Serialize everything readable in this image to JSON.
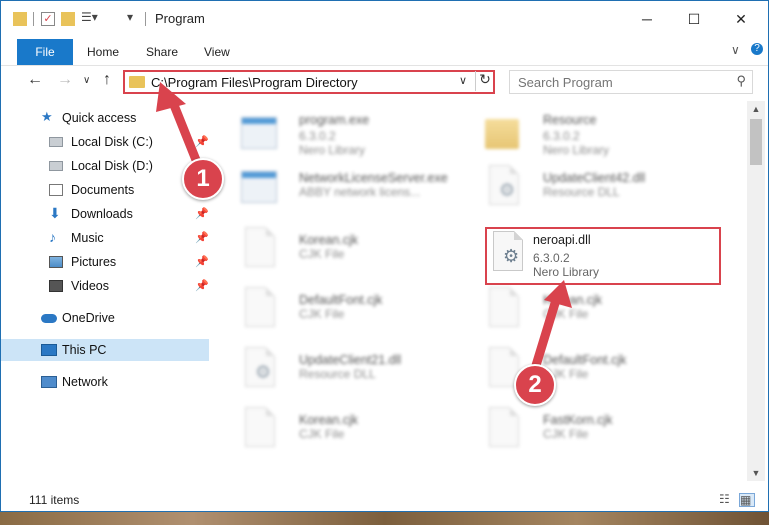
{
  "window": {
    "title": "Program",
    "controls": {
      "minimize": "─",
      "maximize": "☐",
      "close": "✕"
    }
  },
  "ribbon": {
    "tabs": [
      "File",
      "Home",
      "Share",
      "View"
    ],
    "collapse_glyph": "∨",
    "help_glyph": "?"
  },
  "address": {
    "path": "C:\\Program Files\\Program Directory",
    "dropdown_glyph": "∨",
    "refresh_glyph": "↻"
  },
  "search": {
    "placeholder": "Search Program",
    "icon": "search-icon"
  },
  "nav_pane": {
    "items": [
      {
        "label": "Quick access",
        "icon": "star-icon",
        "pinned": false
      },
      {
        "label": "Local Disk (C:)",
        "icon": "drive-icon",
        "pinned": true
      },
      {
        "label": "Local Disk (D:)",
        "icon": "drive-icon",
        "pinned": false
      },
      {
        "label": "Documents",
        "icon": "documents-icon",
        "pinned": false
      },
      {
        "label": "Downloads",
        "icon": "download-icon",
        "pinned": true
      },
      {
        "label": "Music",
        "icon": "music-icon",
        "pinned": true
      },
      {
        "label": "Pictures",
        "icon": "pictures-icon",
        "pinned": true
      },
      {
        "label": "Videos",
        "icon": "videos-icon",
        "pinned": true
      },
      {
        "label": "OneDrive",
        "icon": "cloud-icon",
        "pinned": false
      },
      {
        "label": "This PC",
        "icon": "pc-icon",
        "pinned": false,
        "selected": true
      },
      {
        "label": "Network",
        "icon": "network-icon",
        "pinned": false
      }
    ],
    "pin_glyph": "📌"
  },
  "files": [
    {
      "name": "program.exe",
      "version": "6.3.0.2",
      "type": "Nero Library",
      "icon": "exe-icon"
    },
    {
      "name": "Resource",
      "version": "6.3.0.2",
      "type": "Nero Library",
      "icon": "folder-icon"
    },
    {
      "name": "NetworkLicenseServer.exe",
      "version": "",
      "type": "ABBY network licens...",
      "icon": "exe-icon"
    },
    {
      "name": "UpdateClient42.dll",
      "version": "",
      "type": "Resource DLL",
      "icon": "dll-icon"
    },
    {
      "name": "Korean.cjk",
      "version": "",
      "type": "CJK File",
      "icon": "file-icon"
    },
    {
      "name": "neroapi.dll",
      "version": "6.3.0.2",
      "type": "Nero Library",
      "icon": "dll-icon",
      "highlighted": true
    },
    {
      "name": "DefaultFont.cjk",
      "version": "",
      "type": "CJK File",
      "icon": "file-icon"
    },
    {
      "name": "Korean.cjk",
      "version": "",
      "type": "CJK File",
      "icon": "file-icon"
    },
    {
      "name": "UpdateClient21.dll",
      "version": "",
      "type": "Resource DLL",
      "icon": "dll-icon"
    },
    {
      "name": "DefaultFont.cjk",
      "version": "",
      "type": "CJK File",
      "icon": "file-icon"
    },
    {
      "name": "Korean.cjk",
      "version": "",
      "type": "CJK File",
      "icon": "file-icon"
    },
    {
      "name": "FastKorn.cjk",
      "version": "",
      "type": "CJK File",
      "icon": "file-icon"
    }
  ],
  "status": {
    "item_count": "111 items"
  },
  "annotations": {
    "step1": "1",
    "step2": "2",
    "color": "#d9434d"
  }
}
